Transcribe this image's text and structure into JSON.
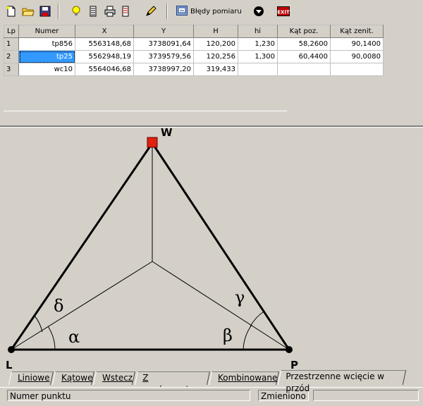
{
  "toolbar": {
    "icons": [
      "new-document-icon",
      "open-folder-icon",
      "save-icon",
      "hint-bulb-icon",
      "list-icon",
      "print-icon",
      "report-icon",
      "edit-pencil-icon"
    ],
    "measurement_errors_label": "Błędy pomiaru",
    "dropdown_icon": "circle-arrow-down-icon",
    "exit_label": "EXIT"
  },
  "table": {
    "headers": [
      "Lp",
      "Numer",
      "X",
      "Y",
      "H",
      "hi",
      "Kąt poz.",
      "Kąt zenit."
    ],
    "rows": [
      {
        "lp": "1",
        "numer": "tp856",
        "x": "5563148,68",
        "y": "3738091,64",
        "h": "120,200",
        "hi": "1,230",
        "kat_poz": "58,2600",
        "kat_zenit": "90,1400"
      },
      {
        "lp": "2",
        "numer": "tp25",
        "x": "5562948,19",
        "y": "3739579,56",
        "h": "120,256",
        "hi": "1,300",
        "kat_poz": "60,4400",
        "kat_zenit": "90,0080"
      },
      {
        "lp": "3",
        "numer": "wc10",
        "x": "5564046,68",
        "y": "3738997,20",
        "h": "319,433",
        "hi": "",
        "kat_poz": "",
        "kat_zenit": ""
      }
    ]
  },
  "diagram": {
    "points": {
      "W": "W",
      "L": "L",
      "P": "P"
    },
    "angles": {
      "alpha": "α",
      "beta": "β",
      "gamma": "γ",
      "delta": "δ"
    },
    "accent_color": "#e02010"
  },
  "tabs": [
    "Liniowe",
    "Kątowe",
    "Wstecz",
    "Z wyrównaniem",
    "Kombinowane",
    "Przestrzenne wcięcie w przód"
  ],
  "active_tab": "Przestrzenne wcięcie w przód",
  "status": {
    "field": "Numer punktu",
    "state": "Zmieniono"
  }
}
